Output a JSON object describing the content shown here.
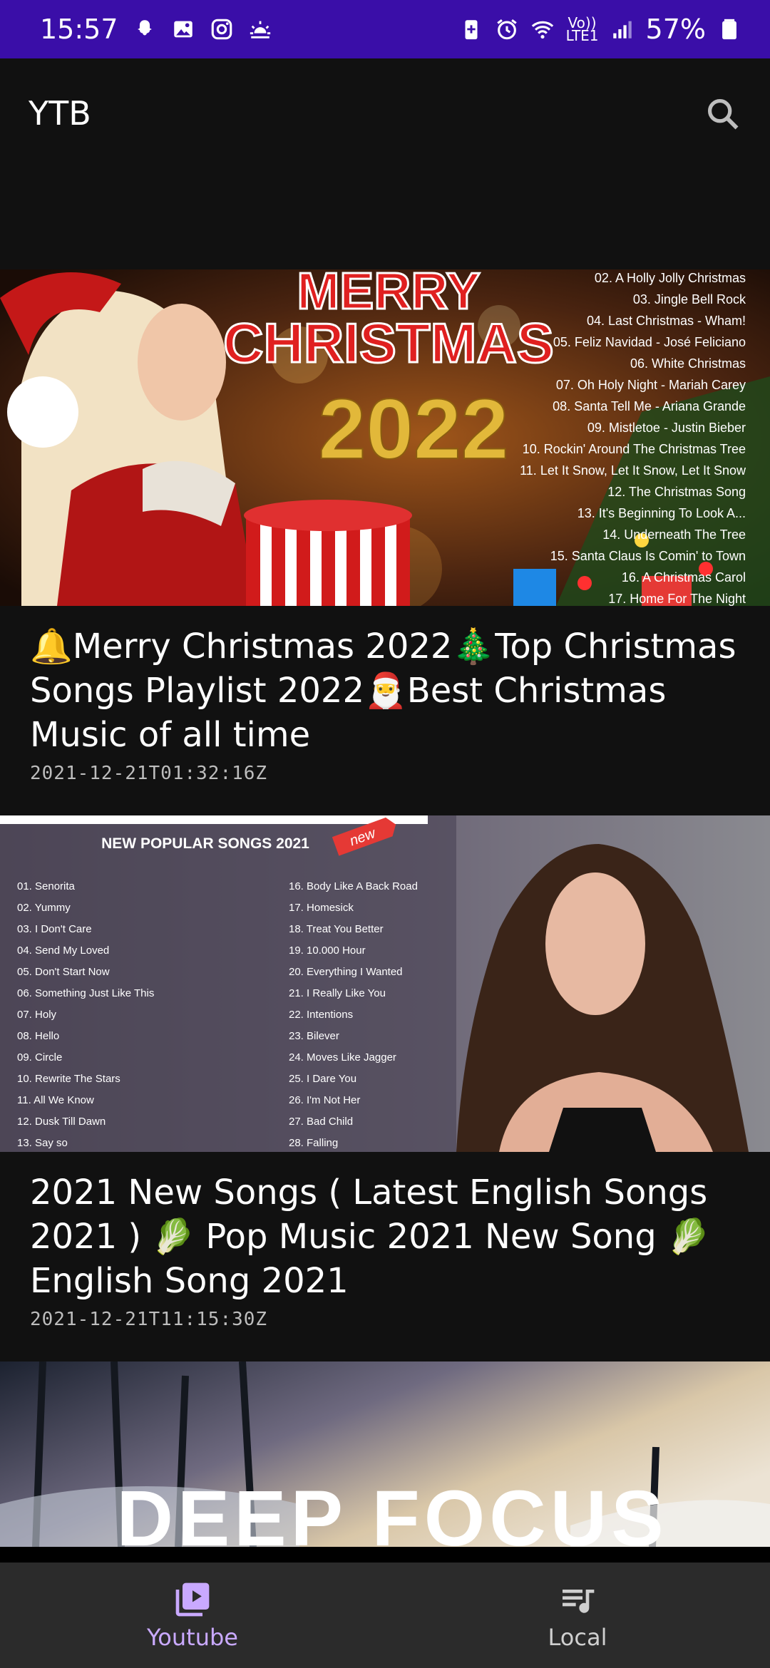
{
  "status_bar": {
    "time": "15:57",
    "battery": "57%",
    "network_top": "Vo))",
    "network_bottom": "LTE1",
    "icons": [
      "snapchat-icon",
      "gallery-icon",
      "instagram-icon",
      "weather-icon",
      "battery-saver-icon",
      "alarm-icon",
      "wifi-icon",
      "signal-icon",
      "battery-icon"
    ]
  },
  "app_bar": {
    "title": "YTB",
    "search_icon": "search-icon"
  },
  "videos": [
    {
      "title": "🔔Merry Christmas 2022🎄Top Christmas Songs Playlist 2022🎅Best Christmas Music of all time",
      "date": "2021-12-21T01:32:16Z",
      "thumb": {
        "heading1": "MERRY",
        "heading2": "CHRISTMAS",
        "year": "2022",
        "tracks": [
          "02. A Holly Jolly Christmas",
          "03. Jingle Bell Rock",
          "04. Last Christmas - Wham!",
          "05. Feliz Navidad - José Feliciano",
          "06. White Christmas",
          "07. Oh Holy Night - Mariah Carey",
          "08. Santa Tell Me - Ariana Grande",
          "09. Mistletoe - Justin Bieber",
          "10. Rockin' Around The Christmas Tree",
          "11. Let It Snow, Let It Snow, Let It Snow",
          "12. The Christmas Song",
          "13. It's Beginning To Look A...",
          "14. Underneath The Tree",
          "15. Santa Claus Is Comin' to Town",
          "16. A Christmas Carol",
          "17. Home For The Night"
        ]
      }
    },
    {
      "title": "2021 New Songs ( Latest English Songs 2021 ) 🥬 Pop Music 2021 New Song 🥬 English Song 2021",
      "date": "2021-12-21T11:15:30Z",
      "thumb": {
        "heading": "NEW POPULAR SONGS 2021",
        "badge": "new",
        "tracks_left": [
          "01. Senorita",
          "02. Yummy",
          "03. I Don't Care",
          "04. Send My Loved",
          "05. Don't Start Now",
          "06. Something Just Like This",
          "07. Holy",
          "08. Hello",
          "09. Circle",
          "10. Rewrite The Stars",
          "11. All We Know",
          "12. Dusk Till Dawn",
          "13. Say so"
        ],
        "tracks_right": [
          "16. Body Like A Back Road",
          "17. Homesick",
          "18. Treat You Better",
          "19. 10.000 Hour",
          "20. Everything I Wanted",
          "21. I Really Like You",
          "22. Intentions",
          "23. Bilever",
          "24. Moves Like Jagger",
          "25. I Dare You",
          "26. I'm Not Her",
          "27. Bad Child",
          "28. Falling"
        ]
      }
    },
    {
      "thumb": {
        "heading": "DEEP FOCUS"
      }
    }
  ],
  "bottom_nav": [
    {
      "label": "Youtube",
      "icon": "video-library-icon",
      "active": true
    },
    {
      "label": "Local",
      "icon": "queue-music-icon",
      "active": false
    }
  ],
  "colors": {
    "status_bar": "#3a0ea8",
    "background": "#111111",
    "accent": "#c9a9ff",
    "nav_bg": "#2b2b2b"
  }
}
